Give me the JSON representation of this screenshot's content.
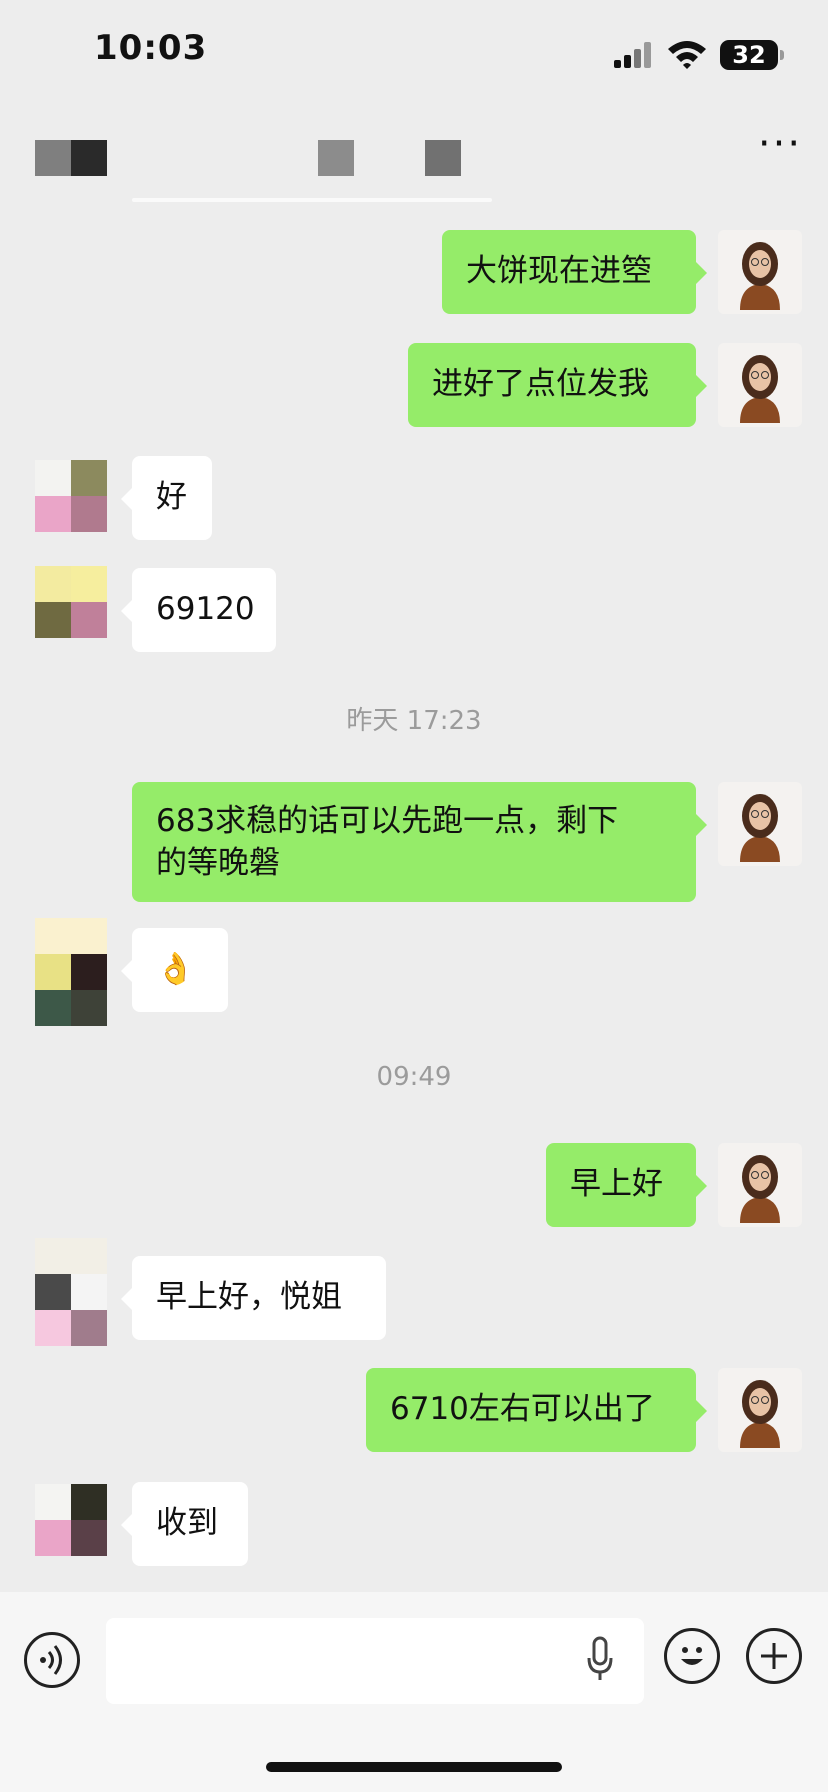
{
  "status_bar": {
    "time": "10:03",
    "battery": "32"
  },
  "header": {
    "more_label": "···"
  },
  "messages": [
    {
      "from": "me",
      "text": "大饼现在进箜"
    },
    {
      "from": "me",
      "text": "进好了点位发我"
    },
    {
      "from": "other",
      "text": "好"
    },
    {
      "from": "other",
      "text": "69120"
    },
    {
      "timestamp": "昨天 17:23"
    },
    {
      "from": "me",
      "text": "683求稳的话可以先跑一点，剩下\n的等晚磐"
    },
    {
      "from": "other",
      "text": "👌"
    },
    {
      "timestamp": "09:49"
    },
    {
      "from": "me",
      "text": "早上好"
    },
    {
      "from": "other",
      "text": "早上好，悦姐"
    },
    {
      "from": "me",
      "text": "6710左右可以出了"
    },
    {
      "from": "other",
      "text": "收到"
    }
  ],
  "input": {
    "placeholder": ""
  },
  "colors": {
    "my_bubble": "#95ec69",
    "other_bubble": "#ffffff",
    "background": "#ededed"
  }
}
